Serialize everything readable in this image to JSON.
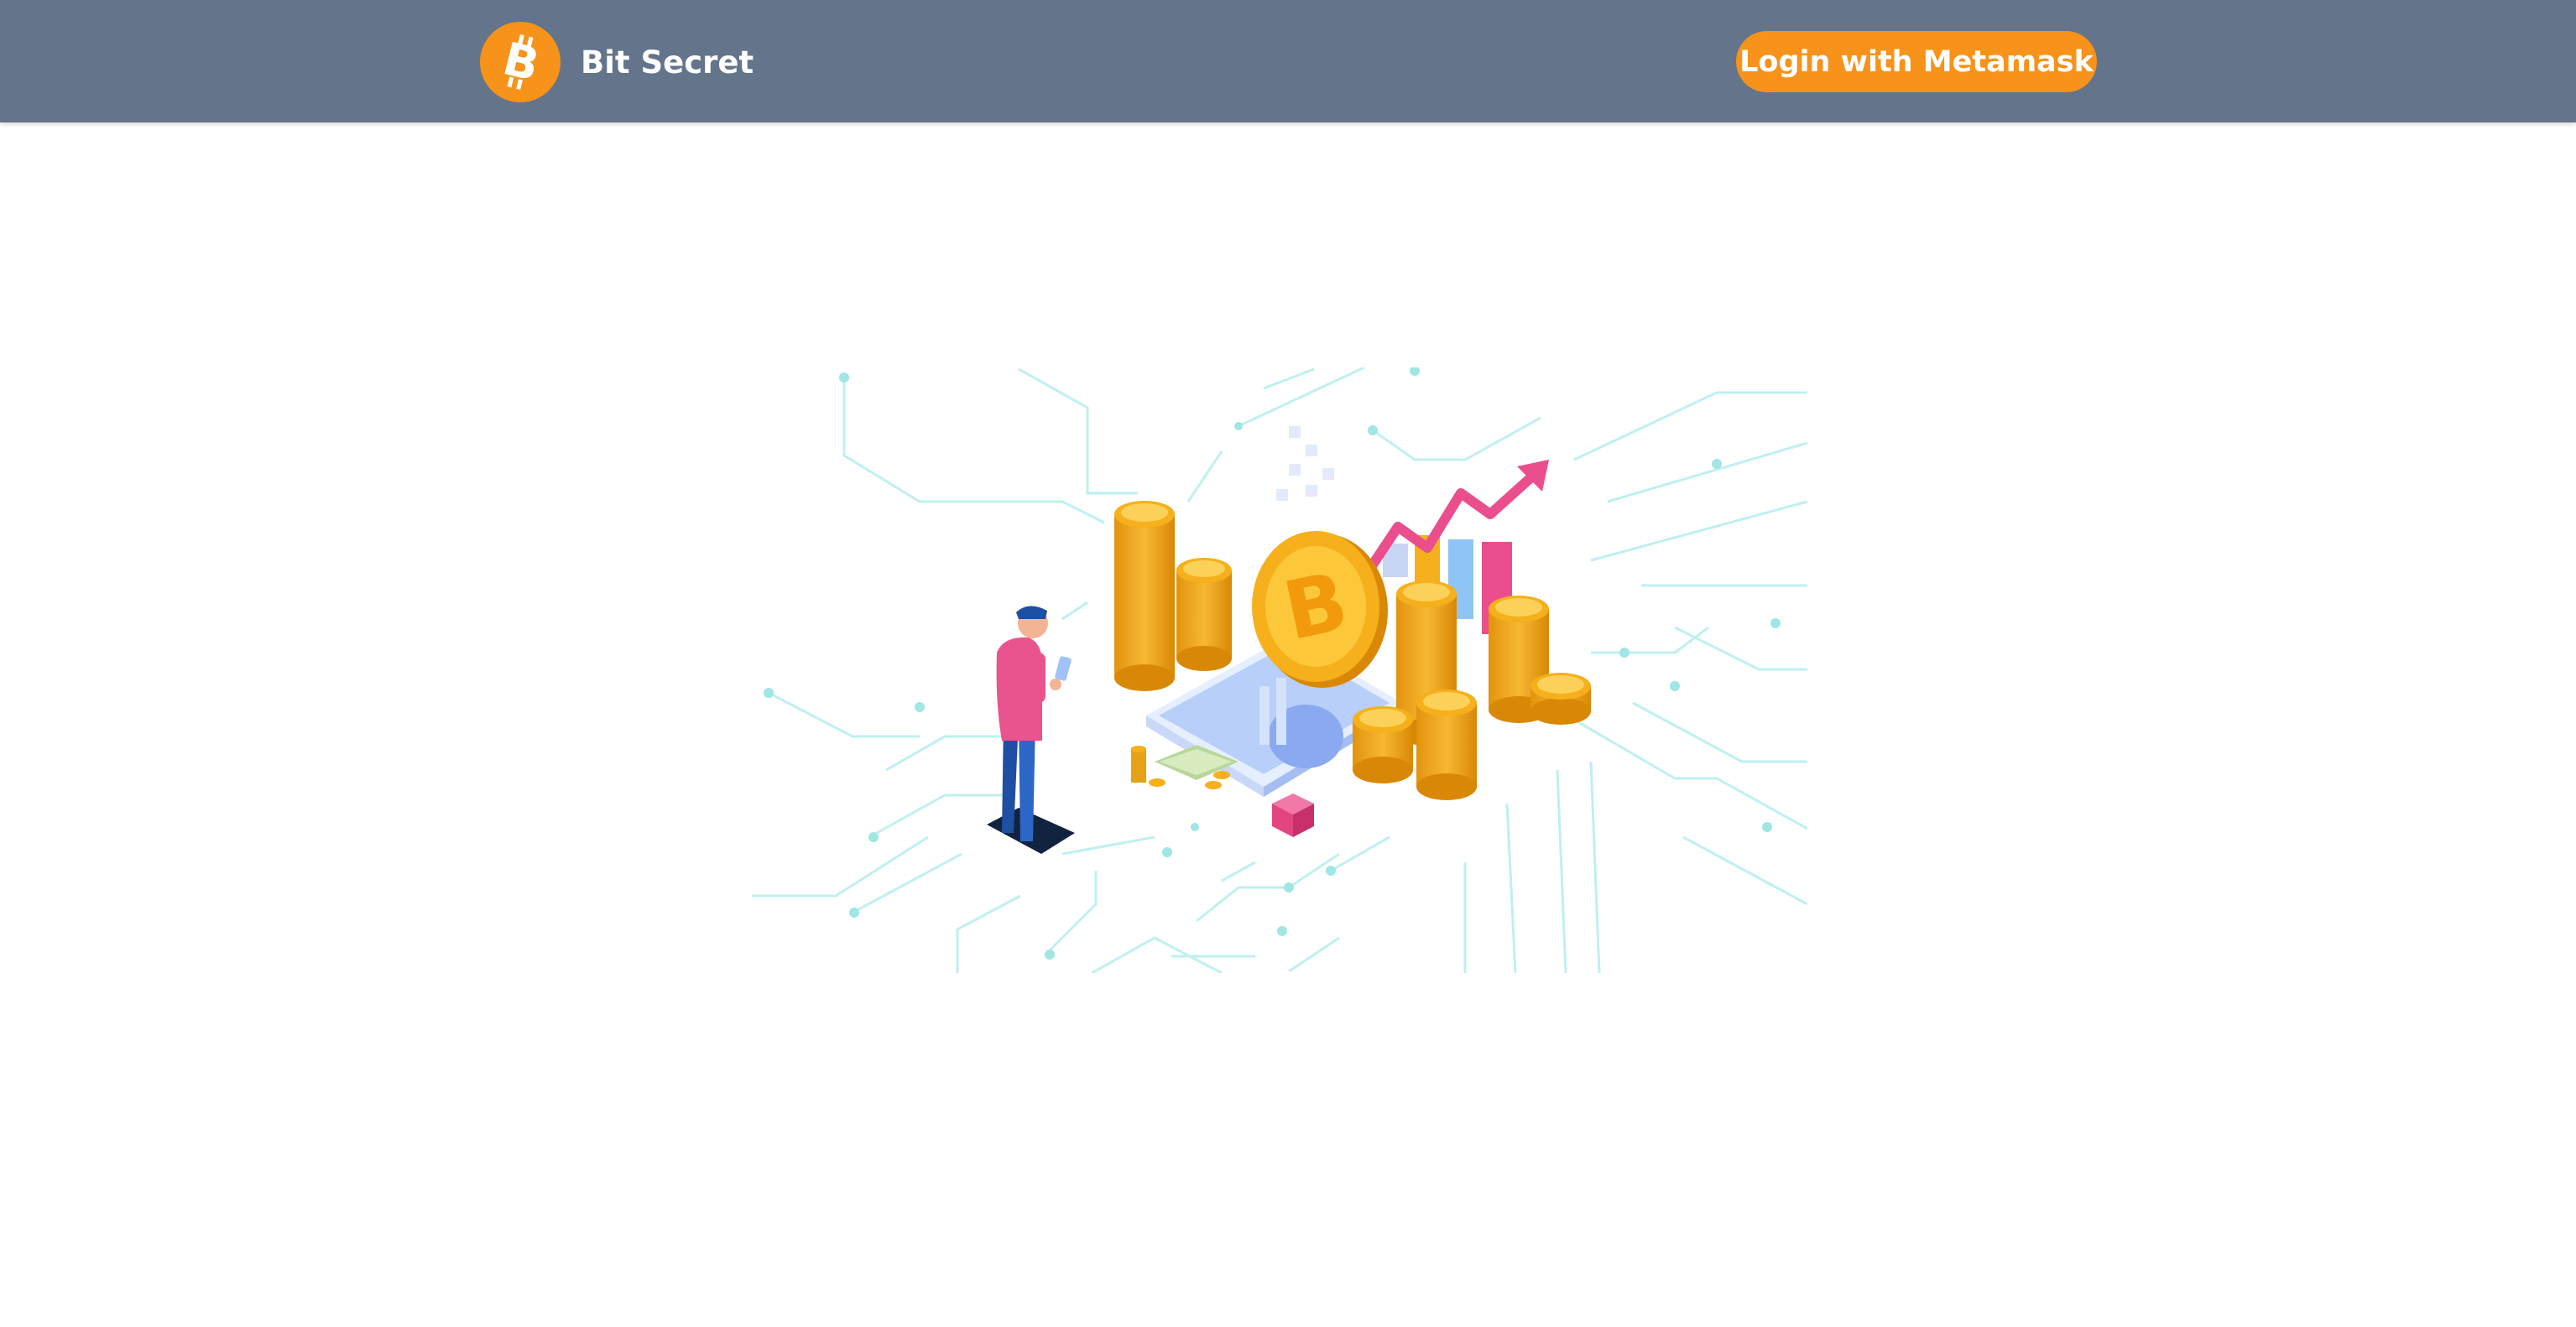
{
  "navbar": {
    "brand": {
      "name": "Bit Secret",
      "logo_icon": "bitcoin-logo-icon",
      "logo_color": "#f7931a"
    },
    "login_button": {
      "label": "Login with Metamask",
      "color": "#f7931a"
    },
    "background": "#64748b"
  },
  "hero": {
    "illustration": "crypto-investment-illustration",
    "accent_colors": {
      "coin": "#f5b01c",
      "circuit": "#bff0ef",
      "person_shirt": "#e9548e",
      "person_pants": "#1e4fa3",
      "phone": "#a9c4f7"
    }
  }
}
